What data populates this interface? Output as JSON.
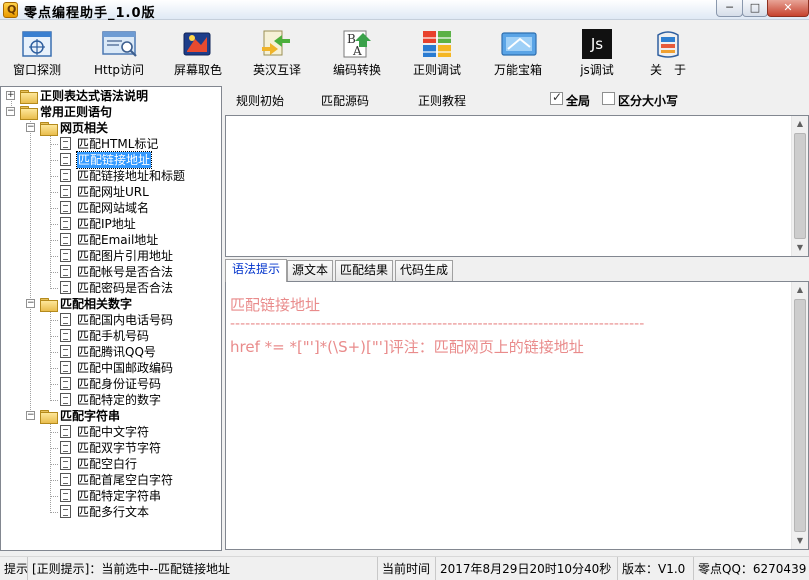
{
  "window": {
    "title": "零点编程助手_1.0版",
    "minimize_glyph": "─",
    "maximize_glyph": "□",
    "close_glyph": "✕"
  },
  "toolbar": {
    "buttons": [
      {
        "label": "窗口探测",
        "icon": "window-probe-icon"
      },
      {
        "label": "Http访问",
        "icon": "http-access-icon"
      },
      {
        "label": "屏幕取色",
        "icon": "color-picker-icon"
      },
      {
        "label": "英汉互译",
        "icon": "translate-icon"
      },
      {
        "label": "编码转换",
        "icon": "encoding-convert-icon"
      },
      {
        "label": "正则调试",
        "icon": "regex-debug-icon"
      },
      {
        "label": "万能宝箱",
        "icon": "toolbox-icon"
      },
      {
        "label": "js调试",
        "icon": "js-debug-icon",
        "icon_text": "Js"
      },
      {
        "label": "关　于",
        "icon": "about-icon"
      }
    ]
  },
  "tree": {
    "root1": "正则表达式语法说明",
    "root2": "常用正则语句",
    "groups": [
      {
        "label": "网页相关",
        "items": [
          "匹配HTML标记",
          "匹配链接地址",
          "匹配链接地址和标题",
          "匹配网址URL",
          "匹配网站域名",
          "匹配IP地址",
          "匹配Email地址",
          "匹配图片引用地址",
          "匹配帐号是否合法",
          "匹配密码是否合法"
        ]
      },
      {
        "label": "匹配相关数字",
        "items": [
          "匹配国内电话号码",
          "匹配手机号码",
          "匹配腾讯QQ号",
          "匹配中国邮政编码",
          "匹配身份证号码",
          "匹配特定的数字"
        ]
      },
      {
        "label": "匹配字符串",
        "items": [
          "匹配中文字符",
          "匹配双字节字符",
          "匹配空白行",
          "匹配首尾空白字符",
          "匹配特定字符串",
          "匹配多行文本"
        ]
      }
    ],
    "selected_item": "匹配链接地址"
  },
  "header": {
    "rule_init": "规则初始",
    "match_source": "匹配源码",
    "regex_tutorial": "正则教程",
    "global_label": "全局",
    "global_checked": true,
    "case_label": "区分大小写",
    "case_checked": false
  },
  "tabs": [
    {
      "label": "语法提示",
      "active": true
    },
    {
      "label": "源文本",
      "active": false
    },
    {
      "label": "匹配结果",
      "active": false
    },
    {
      "label": "代码生成",
      "active": false
    }
  ],
  "output": {
    "title": "匹配链接地址",
    "separator": "----------------------------------------------------------------------------------",
    "regex_line": "href *= *[\"']*(\\S+)[\"']评注：匹配网页上的链接地址"
  },
  "status": {
    "hint_label": "提示",
    "hint_text": "[正则提示]：当前选中--匹配链接地址",
    "time_label": "当前时间",
    "time_value": "2017年8月29日20时10分40秒",
    "version": "版本：V1.0",
    "qq": "零点QQ：6270439"
  }
}
